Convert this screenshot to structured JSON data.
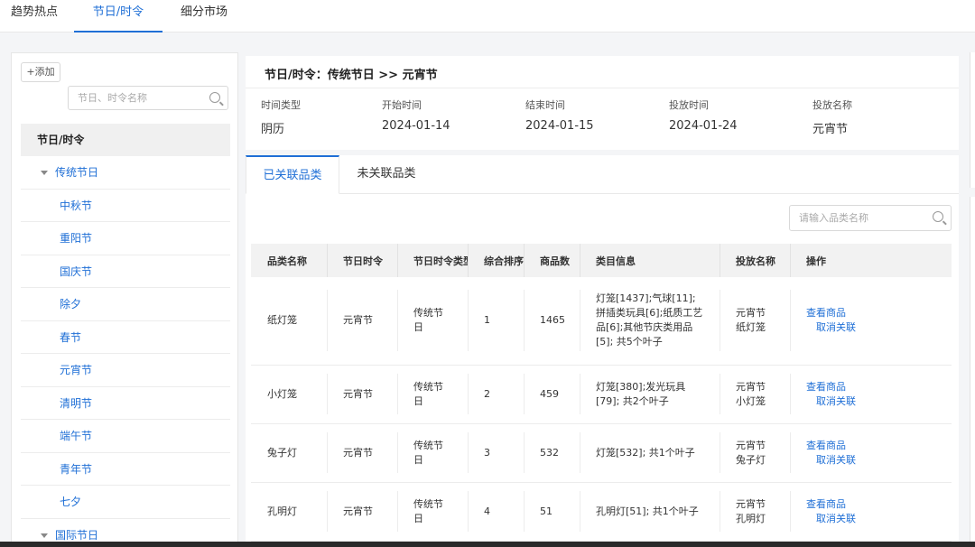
{
  "topnav": {
    "tabs": [
      {
        "label": "趋势热点"
      },
      {
        "label": "节日/时令"
      },
      {
        "label": "细分市场"
      }
    ]
  },
  "left": {
    "add_label": "+添加",
    "search_placeholder": "节日、时令名称",
    "tree_header": "节日/时令",
    "parent1": "传统节日",
    "children": [
      "中秋节",
      "重阳节",
      "国庆节",
      "除夕",
      "春节",
      "元宵节",
      "清明节",
      "端午节",
      "青年节",
      "七夕"
    ],
    "parent2": "国际节日"
  },
  "info": {
    "breadcrumb": "节日/时令：传统节日 >> 元宵节",
    "fields": [
      {
        "label": "时间类型",
        "value": "阴历"
      },
      {
        "label": "开始时间",
        "value": "2024-01-14"
      },
      {
        "label": "结束时间",
        "value": "2024-01-15"
      },
      {
        "label": "投放时间",
        "value": "2024-01-24"
      },
      {
        "label": "投放名称",
        "value": "元宵节"
      }
    ]
  },
  "tabs": {
    "linked": "已关联品类",
    "unlinked": "未关联品类"
  },
  "category_search_placeholder": "请输入品类名称",
  "table": {
    "headers": [
      "品类名称",
      "节日时令",
      "节日时令类型",
      "综合排序",
      "商品数",
      "类目信息",
      "投放名称",
      "操作"
    ],
    "rows": [
      {
        "name": "纸灯笼",
        "festival": "元宵节",
        "type": "传统节日",
        "rank": "1",
        "count": "1465",
        "info": "灯笼[1437];气球[11];拼插类玩具[6];纸质工艺品[6];其他节庆类用品[5]; 共5个叶子",
        "put_name": "元宵节纸灯笼",
        "view": "查看商品",
        "unlink": "取消关联"
      },
      {
        "name": "小灯笼",
        "festival": "元宵节",
        "type": "传统节日",
        "rank": "2",
        "count": "459",
        "info": "灯笼[380];发光玩具[79]; 共2个叶子",
        "put_name": "元宵节小灯笼",
        "view": "查看商品",
        "unlink": "取消关联"
      },
      {
        "name": "兔子灯",
        "festival": "元宵节",
        "type": "传统节日",
        "rank": "3",
        "count": "532",
        "info": "灯笼[532]; 共1个叶子",
        "put_name": "元宵节兔子灯",
        "view": "查看商品",
        "unlink": "取消关联"
      },
      {
        "name": "孔明灯",
        "festival": "元宵节",
        "type": "传统节日",
        "rank": "4",
        "count": "51",
        "info": "孔明灯[51]; 共1个叶子",
        "put_name": "元宵节孔明灯",
        "view": "查看商品",
        "unlink": "取消关联"
      }
    ]
  }
}
